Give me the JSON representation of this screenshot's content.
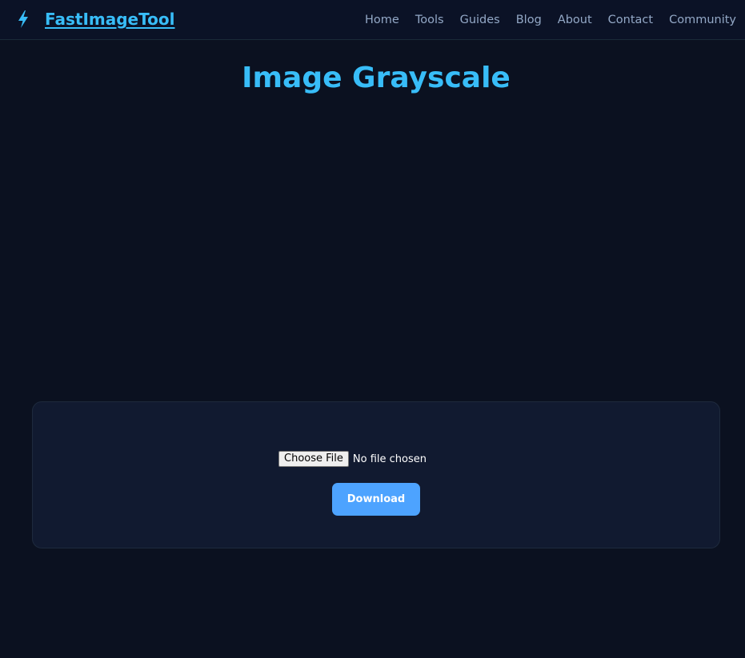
{
  "navbar": {
    "brand": {
      "icon": "lightning-bolt-icon",
      "text": "FastImageTool"
    },
    "links": [
      {
        "label": "Home"
      },
      {
        "label": "Tools"
      },
      {
        "label": "Guides"
      },
      {
        "label": "Blog"
      },
      {
        "label": "About"
      },
      {
        "label": "Contact"
      },
      {
        "label": "Community"
      }
    ]
  },
  "main": {
    "title": "Image Grayscale",
    "upload": {
      "choose_file_label": "Choose File",
      "file_status": "No file chosen",
      "download_label": "Download"
    }
  },
  "colors": {
    "background": "#0b1120",
    "navbar_background": "#0b1226",
    "accent": "#38bdf8",
    "card_background": "#111a30",
    "button_background": "#4da3ff",
    "nav_link": "#93a8c6"
  }
}
